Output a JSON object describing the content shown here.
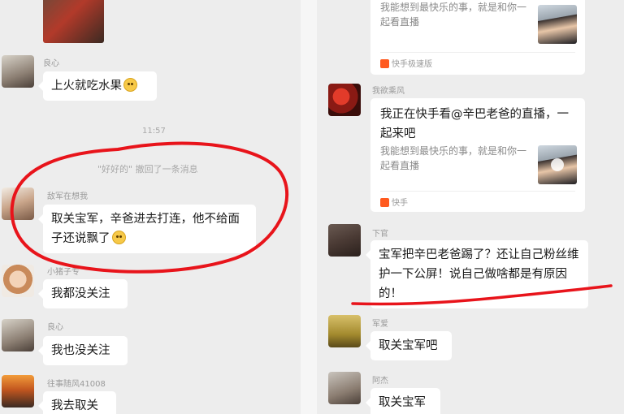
{
  "left": {
    "messages": [
      {
        "nick": "良心",
        "text": "上火就吃水果",
        "emoji": "blush-emoji"
      },
      {
        "nick": "敌军在想我",
        "text": "取关宝军，辛爸进去打连，他不给面子还说飘了",
        "emoji": "blush-emoji"
      },
      {
        "nick": "小猪子专",
        "text": "我都没关注"
      },
      {
        "nick": "良心",
        "text": "我也没关注"
      },
      {
        "nick": "往事随风41008",
        "text": "我去取关"
      }
    ],
    "time": "11:57",
    "system_note": "\"好好的\" 撤回了一条消息"
  },
  "right": {
    "card1": {
      "desc": "我能想到最快乐的事，就是和你一起看直播",
      "source": "快手极速版"
    },
    "card2": {
      "nick": "我欲乘风",
      "title": "我正在快手看@辛巴老爸的直播，一起来吧",
      "desc": "我能想到最快乐的事，就是和你一起看直播",
      "source": "快手"
    },
    "messages": [
      {
        "nick": "下官",
        "text": "宝军把辛巴老爸踢了？还让自己粉丝维护一下公屏！说自己做啥都是有原因的！"
      },
      {
        "nick": "军爱",
        "text": "取关宝军吧"
      },
      {
        "nick": "阿杰",
        "text": "取关宝军"
      }
    ]
  },
  "annotation_color": "#e8141b"
}
